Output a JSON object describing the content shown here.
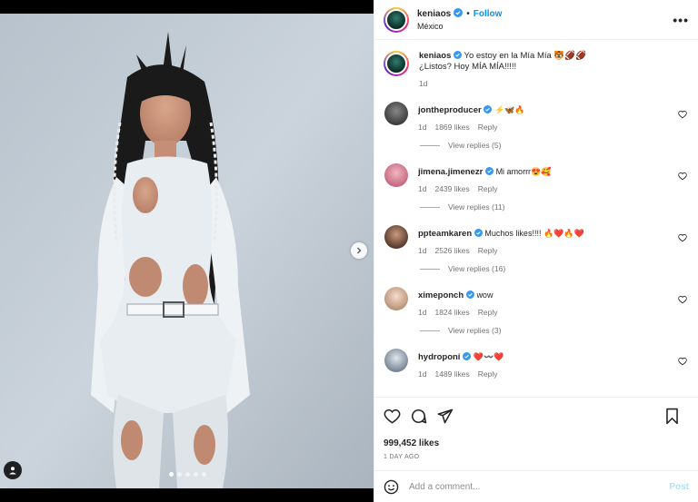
{
  "media": {
    "carousel_dots": 5,
    "active_dot": 0
  },
  "header": {
    "username": "keniaos",
    "separator": "•",
    "follow_label": "Follow",
    "location": "México",
    "more_label": "•••"
  },
  "caption": {
    "username": "keniaos",
    "line1": "Yo estoy en la Mía Mía 🐯🏈🏈",
    "line2": "¿Listos? Hoy MÍA MÍA!!!!!",
    "time": "1d"
  },
  "comments": [
    {
      "username": "jontheproducer",
      "text": "⚡🦋🔥",
      "time": "1d",
      "likes": "1869 likes",
      "reply": "Reply",
      "view_replies": "View replies (5)"
    },
    {
      "username": "jimena.jimenezr",
      "text": "Mi amorrr😍🥰",
      "time": "1d",
      "likes": "2439 likes",
      "reply": "Reply",
      "view_replies": "View replies (11)"
    },
    {
      "username": "ppteamkaren",
      "text": "Muchos likes!!!! 🔥❤️🔥❤️",
      "time": "1d",
      "likes": "2526 likes",
      "reply": "Reply",
      "view_replies": "View replies (16)"
    },
    {
      "username": "ximeponch",
      "text": "wow",
      "time": "1d",
      "likes": "1824 likes",
      "reply": "Reply",
      "view_replies": "View replies (3)"
    },
    {
      "username": "hydroponi",
      "text": "❤️〰️❤️",
      "time": "1d",
      "likes": "1489 likes",
      "reply": "Reply"
    }
  ],
  "actions": {
    "likes": "999,452 likes",
    "time_ago": "1 DAY AGO"
  },
  "add_comment": {
    "placeholder": "Add a comment...",
    "post_label": "Post"
  },
  "colors": {
    "accent": "#0095f6",
    "verified": "#3897f0",
    "muted": "#737373"
  },
  "icons": [
    "verified-icon",
    "more-icon",
    "heart-icon",
    "comment-icon",
    "share-icon",
    "bookmark-icon",
    "emoji-icon",
    "chevron-right-icon",
    "user-tag-icon"
  ]
}
